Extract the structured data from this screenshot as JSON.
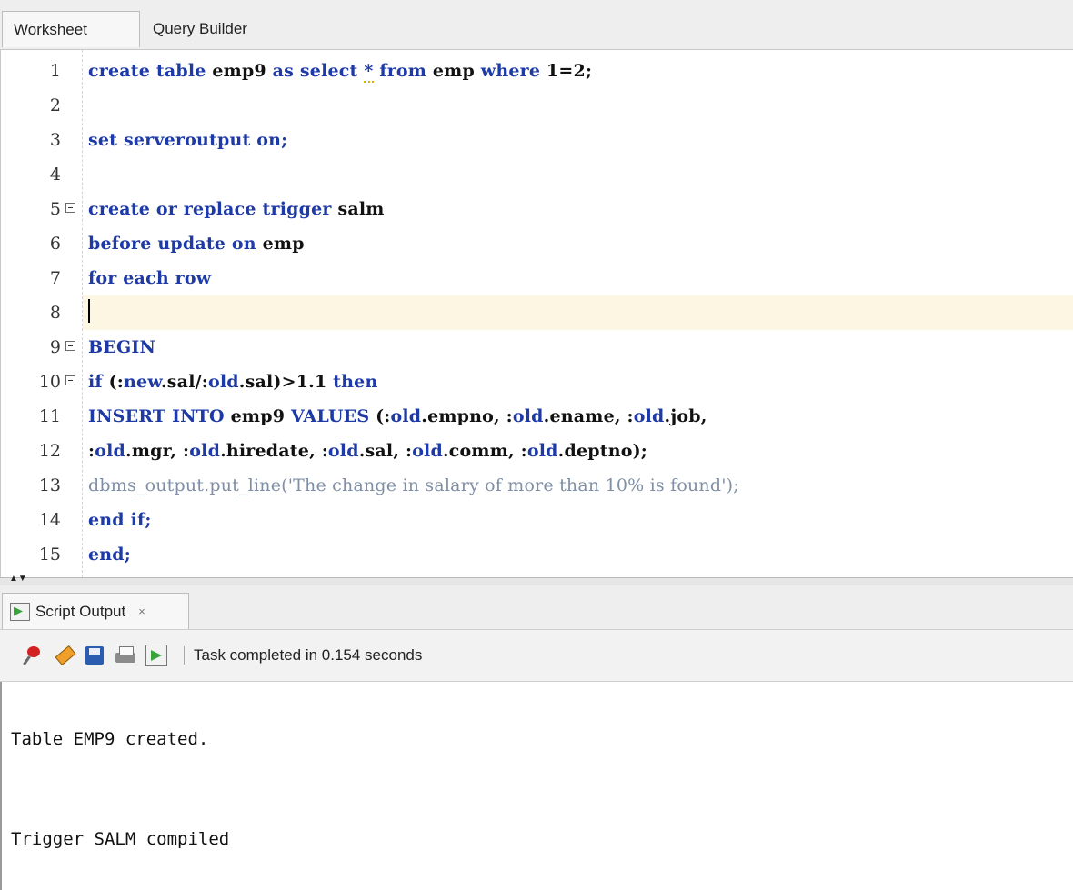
{
  "tabs": [
    {
      "label": "Worksheet",
      "active": true
    },
    {
      "label": "Query Builder",
      "active": false
    }
  ],
  "editor": {
    "line_numbers": [
      "1",
      "2",
      "3",
      "4",
      "5",
      "6",
      "7",
      "8",
      "9",
      "10",
      "11",
      "12",
      "13",
      "14",
      "15"
    ],
    "lines": [
      [
        {
          "t": "create table ",
          "c": "kw"
        },
        {
          "t": "emp9 ",
          "c": "id"
        },
        {
          "t": "as select ",
          "c": "kw"
        },
        {
          "t": "*",
          "c": "kw"
        },
        {
          "t": " from ",
          "c": "kw"
        },
        {
          "t": "emp ",
          "c": "id"
        },
        {
          "t": "where ",
          "c": "kw"
        },
        {
          "t": "1",
          "c": "num"
        },
        {
          "t": "=",
          "c": "id"
        },
        {
          "t": "2",
          "c": "num"
        },
        {
          "t": ";",
          "c": "id"
        }
      ],
      [],
      [
        {
          "t": "set serveroutput on;",
          "c": "kw"
        }
      ],
      [],
      [
        {
          "t": "create or replace trigger ",
          "c": "kw"
        },
        {
          "t": "salm",
          "c": "id"
        }
      ],
      [
        {
          "t": "before update on ",
          "c": "kw"
        },
        {
          "t": "emp",
          "c": "id"
        }
      ],
      [
        {
          "t": "for each row",
          "c": "kw"
        }
      ],
      [],
      [
        {
          "t": "BEGIN",
          "c": "kw"
        }
      ],
      [
        {
          "t": "if ",
          "c": "kw"
        },
        {
          "t": "(:",
          "c": "id"
        },
        {
          "t": "new",
          "c": "kw"
        },
        {
          "t": ".sal/:",
          "c": "id"
        },
        {
          "t": "old",
          "c": "kw"
        },
        {
          "t": ".sal)>",
          "c": "id"
        },
        {
          "t": "1.1",
          "c": "num"
        },
        {
          "t": " then",
          "c": "kw"
        }
      ],
      [
        {
          "t": "INSERT INTO ",
          "c": "kw"
        },
        {
          "t": "emp9 ",
          "c": "id"
        },
        {
          "t": "VALUES ",
          "c": "kw"
        },
        {
          "t": "(:",
          "c": "id"
        },
        {
          "t": "old",
          "c": "kw"
        },
        {
          "t": ".empno, :",
          "c": "id"
        },
        {
          "t": "old",
          "c": "kw"
        },
        {
          "t": ".ename, :",
          "c": "id"
        },
        {
          "t": "old",
          "c": "kw"
        },
        {
          "t": ".job,",
          "c": "id"
        }
      ],
      [
        {
          "t": ":",
          "c": "id"
        },
        {
          "t": "old",
          "c": "kw"
        },
        {
          "t": ".mgr, :",
          "c": "id"
        },
        {
          "t": "old",
          "c": "kw"
        },
        {
          "t": ".hiredate, :",
          "c": "id"
        },
        {
          "t": "old",
          "c": "kw"
        },
        {
          "t": ".sal, :",
          "c": "id"
        },
        {
          "t": "old",
          "c": "kw"
        },
        {
          "t": ".comm, :",
          "c": "id"
        },
        {
          "t": "old",
          "c": "kw"
        },
        {
          "t": ".deptno);",
          "c": "id"
        }
      ],
      [
        {
          "t": "dbms_output.put_line('The change in salary of more than 10% is found');",
          "c": "cm"
        }
      ],
      [
        {
          "t": "end if;",
          "c": "kw"
        }
      ],
      [
        {
          "t": "end;",
          "c": "kw"
        }
      ]
    ],
    "fold_lines": [
      5,
      9,
      10
    ],
    "cursor_line": 8
  },
  "output": {
    "tab_label": "Script Output",
    "close_symbol": "×",
    "status": "Task completed in 0.154 seconds",
    "lines": [
      "Table EMP9 created.",
      "Trigger SALM compiled"
    ]
  },
  "colors": {
    "keyword": "#1d3aa6",
    "comment": "#7f8fa6",
    "current_line": "#fdf6e3"
  },
  "icons": [
    "pin-icon",
    "eraser-icon",
    "save-icon",
    "print-icon",
    "run-script-icon"
  ]
}
